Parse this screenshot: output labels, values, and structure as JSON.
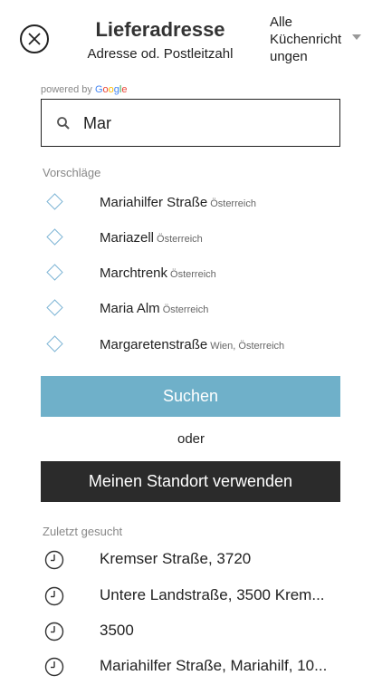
{
  "header": {
    "title": "Lieferadresse",
    "subtitle": "Adresse od. Postleitzahl",
    "cuisine_filter": "Alle Küchenrichtungen",
    "cuisine_filter_lines": [
      "Alle",
      "Küchenricht",
      "ungen"
    ]
  },
  "powered_by": {
    "prefix": "powered by",
    "brand_letters": [
      "G",
      "o",
      "o",
      "g",
      "l",
      "e"
    ]
  },
  "search": {
    "value": "Mar",
    "placeholder": ""
  },
  "suggestions": {
    "label": "Vorschläge",
    "items": [
      {
        "main": "Mariahilfer Straße",
        "sub": "Österreich"
      },
      {
        "main": "Mariazell",
        "sub": "Österreich"
      },
      {
        "main": "Marchtrenk",
        "sub": "Österreich"
      },
      {
        "main": "Maria Alm",
        "sub": "Österreich"
      },
      {
        "main": "Margaretenstraße",
        "sub": "Wien, Österreich"
      }
    ]
  },
  "actions": {
    "search_label": "Suchen",
    "or_label": "oder",
    "location_label": "Meinen Standort verwenden"
  },
  "recent": {
    "label": "Zuletzt gesucht",
    "items": [
      "Kremser Straße, 3720",
      "Untere Landstraße, 3500 Krem...",
      "3500",
      "Mariahilfer Straße, Mariahilf, 10..."
    ]
  },
  "colors": {
    "accent": "#6fb0c9",
    "dark_button": "#2b2b2b",
    "diamond": "#7fb6d6"
  },
  "icons": {
    "close": "close-icon",
    "search": "search-icon",
    "dropdown": "chevron-down-icon",
    "suggestion": "diamond-icon",
    "recent": "clock-icon"
  }
}
